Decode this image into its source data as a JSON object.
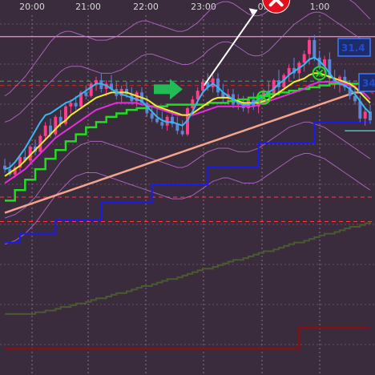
{
  "chart_data": {
    "type": "candlestick",
    "x_tick_labels": [
      "20:00",
      "21:00",
      "22:00",
      "23:00",
      "0:",
      "1:00"
    ],
    "price_tags": [
      "31.4",
      "34"
    ],
    "grid": true,
    "background": "#3a2c3c",
    "colors": {
      "bull_candle": "#ff3d8b",
      "bear_candle": "#5f86d6",
      "fast_ma": "#36b8f0",
      "yellow_ma": "#f2ee2a",
      "magenta_ma": "#e82ce0",
      "green_step": "#22dd22",
      "salmon_ma": "#f2a58c",
      "blue_step": "#1a1aee",
      "olive_step": "#4a5a30",
      "red_step": "#9a0808",
      "bands": "#b86bd0",
      "pink_level": "#f27bc8",
      "grid": "#8a6e88",
      "signal_green": "#22bb55",
      "signal_red": "#e0101c",
      "price_tag_bg": "#1e2c6e",
      "price_tag_border": "#3a7cff"
    },
    "candles": [
      {
        "o": 100,
        "h": 108,
        "l": 92,
        "c": 96
      },
      {
        "o": 96,
        "h": 104,
        "l": 88,
        "c": 90
      },
      {
        "o": 90,
        "h": 100,
        "l": 86,
        "c": 98
      },
      {
        "o": 98,
        "h": 112,
        "l": 94,
        "c": 110
      },
      {
        "o": 110,
        "h": 118,
        "l": 104,
        "c": 106
      },
      {
        "o": 106,
        "h": 124,
        "l": 102,
        "c": 122
      },
      {
        "o": 122,
        "h": 130,
        "l": 112,
        "c": 116
      },
      {
        "o": 116,
        "h": 136,
        "l": 114,
        "c": 134
      },
      {
        "o": 134,
        "h": 150,
        "l": 130,
        "c": 146
      },
      {
        "o": 146,
        "h": 154,
        "l": 132,
        "c": 136
      },
      {
        "o": 136,
        "h": 158,
        "l": 134,
        "c": 156
      },
      {
        "o": 156,
        "h": 164,
        "l": 144,
        "c": 148
      },
      {
        "o": 148,
        "h": 170,
        "l": 146,
        "c": 168
      },
      {
        "o": 168,
        "h": 176,
        "l": 160,
        "c": 172
      },
      {
        "o": 172,
        "h": 180,
        "l": 164,
        "c": 168
      },
      {
        "o": 168,
        "h": 186,
        "l": 166,
        "c": 184
      },
      {
        "o": 184,
        "h": 192,
        "l": 176,
        "c": 180
      },
      {
        "o": 180,
        "h": 196,
        "l": 178,
        "c": 194
      },
      {
        "o": 194,
        "h": 202,
        "l": 186,
        "c": 198
      },
      {
        "o": 198,
        "h": 206,
        "l": 184,
        "c": 188
      },
      {
        "o": 188,
        "h": 198,
        "l": 180,
        "c": 194
      },
      {
        "o": 194,
        "h": 204,
        "l": 186,
        "c": 188
      },
      {
        "o": 188,
        "h": 196,
        "l": 176,
        "c": 180
      },
      {
        "o": 180,
        "h": 192,
        "l": 172,
        "c": 188
      },
      {
        "o": 188,
        "h": 196,
        "l": 178,
        "c": 182
      },
      {
        "o": 182,
        "h": 190,
        "l": 170,
        "c": 174
      },
      {
        "o": 174,
        "h": 186,
        "l": 168,
        "c": 184
      },
      {
        "o": 184,
        "h": 190,
        "l": 170,
        "c": 172
      },
      {
        "o": 172,
        "h": 180,
        "l": 156,
        "c": 160
      },
      {
        "o": 160,
        "h": 168,
        "l": 150,
        "c": 154
      },
      {
        "o": 154,
        "h": 166,
        "l": 148,
        "c": 150
      },
      {
        "o": 150,
        "h": 162,
        "l": 142,
        "c": 146
      },
      {
        "o": 146,
        "h": 158,
        "l": 140,
        "c": 156
      },
      {
        "o": 156,
        "h": 164,
        "l": 144,
        "c": 148
      },
      {
        "o": 148,
        "h": 156,
        "l": 136,
        "c": 140
      },
      {
        "o": 140,
        "h": 152,
        "l": 134,
        "c": 136
      },
      {
        "o": 136,
        "h": 168,
        "l": 134,
        "c": 166
      },
      {
        "o": 166,
        "h": 180,
        "l": 162,
        "c": 176
      },
      {
        "o": 176,
        "h": 190,
        "l": 170,
        "c": 186
      },
      {
        "o": 186,
        "h": 200,
        "l": 180,
        "c": 196
      },
      {
        "o": 196,
        "h": 206,
        "l": 186,
        "c": 190
      },
      {
        "o": 190,
        "h": 204,
        "l": 184,
        "c": 200
      },
      {
        "o": 200,
        "h": 206,
        "l": 180,
        "c": 184
      },
      {
        "o": 184,
        "h": 194,
        "l": 172,
        "c": 178
      },
      {
        "o": 178,
        "h": 188,
        "l": 170,
        "c": 182
      },
      {
        "o": 182,
        "h": 188,
        "l": 166,
        "c": 170
      },
      {
        "o": 170,
        "h": 182,
        "l": 164,
        "c": 172
      },
      {
        "o": 172,
        "h": 180,
        "l": 162,
        "c": 166
      },
      {
        "o": 166,
        "h": 178,
        "l": 160,
        "c": 176
      },
      {
        "o": 176,
        "h": 184,
        "l": 164,
        "c": 168
      },
      {
        "o": 168,
        "h": 180,
        "l": 160,
        "c": 178
      },
      {
        "o": 178,
        "h": 188,
        "l": 170,
        "c": 186
      },
      {
        "o": 186,
        "h": 196,
        "l": 176,
        "c": 180
      },
      {
        "o": 180,
        "h": 200,
        "l": 178,
        "c": 198
      },
      {
        "o": 198,
        "h": 210,
        "l": 184,
        "c": 190
      },
      {
        "o": 190,
        "h": 206,
        "l": 186,
        "c": 204
      },
      {
        "o": 204,
        "h": 216,
        "l": 196,
        "c": 212
      },
      {
        "o": 212,
        "h": 224,
        "l": 200,
        "c": 206
      },
      {
        "o": 206,
        "h": 220,
        "l": 198,
        "c": 218
      },
      {
        "o": 218,
        "h": 232,
        "l": 208,
        "c": 228
      },
      {
        "o": 228,
        "h": 248,
        "l": 216,
        "c": 244
      },
      {
        "o": 244,
        "h": 250,
        "l": 220,
        "c": 224
      },
      {
        "o": 224,
        "h": 232,
        "l": 210,
        "c": 214
      },
      {
        "o": 214,
        "h": 226,
        "l": 206,
        "c": 222
      },
      {
        "o": 222,
        "h": 230,
        "l": 196,
        "c": 200
      },
      {
        "o": 200,
        "h": 210,
        "l": 188,
        "c": 194
      },
      {
        "o": 194,
        "h": 204,
        "l": 184,
        "c": 202
      },
      {
        "o": 202,
        "h": 210,
        "l": 186,
        "c": 190
      },
      {
        "o": 190,
        "h": 198,
        "l": 176,
        "c": 180
      },
      {
        "o": 180,
        "h": 192,
        "l": 170,
        "c": 174
      },
      {
        "o": 174,
        "h": 180,
        "l": 150,
        "c": 154
      },
      {
        "o": 154,
        "h": 166,
        "l": 146,
        "c": 162
      },
      {
        "o": 162,
        "h": 170,
        "l": 148,
        "c": 152
      }
    ],
    "fast_ma": [
      96,
      98,
      104,
      112,
      120,
      130,
      140,
      150,
      158,
      160,
      164,
      168,
      172,
      174,
      178,
      182,
      186,
      190,
      194,
      194,
      192,
      188,
      184,
      182,
      180,
      178,
      176,
      174,
      168,
      162,
      156,
      152,
      150,
      150,
      148,
      146,
      152,
      162,
      174,
      184,
      190,
      194,
      190,
      184,
      180,
      176,
      172,
      170,
      170,
      172,
      176,
      180,
      184,
      188,
      194,
      198,
      204,
      208,
      212,
      216,
      222,
      224,
      220,
      214,
      206,
      198,
      194,
      192,
      188,
      182,
      174,
      166,
      160
    ],
    "yellow_ma": [
      88,
      92,
      96,
      100,
      106,
      112,
      118,
      124,
      130,
      136,
      142,
      148,
      152,
      158,
      162,
      166,
      170,
      174,
      178,
      180,
      182,
      184,
      184,
      184,
      184,
      182,
      180,
      178,
      176,
      172,
      168,
      166,
      164,
      162,
      160,
      158,
      158,
      160,
      164,
      168,
      172,
      176,
      178,
      178,
      178,
      176,
      174,
      172,
      172,
      172,
      172,
      174,
      176,
      180,
      184,
      188,
      192,
      196,
      198,
      200,
      204,
      206,
      206,
      204,
      202,
      200,
      198,
      196,
      194,
      190,
      184,
      178,
      172
    ],
    "magenta_ma": [
      80,
      84,
      88,
      92,
      96,
      102,
      108,
      114,
      120,
      126,
      132,
      136,
      140,
      144,
      148,
      152,
      156,
      160,
      164,
      166,
      168,
      170,
      172,
      172,
      172,
      172,
      172,
      170,
      170,
      168,
      166,
      164,
      162,
      160,
      158,
      158,
      158,
      158,
      160,
      162,
      164,
      166,
      168,
      168,
      168,
      168,
      168,
      168,
      168,
      168,
      170,
      172,
      174,
      176,
      178,
      180,
      182,
      184,
      186,
      188,
      192,
      194,
      196,
      196,
      196,
      196,
      196,
      194,
      192,
      190,
      186,
      182,
      176
    ],
    "salmon_ma": [
      46,
      48,
      50,
      52,
      54,
      56,
      58,
      60,
      62,
      64,
      66,
      68,
      70,
      72,
      74,
      76,
      78,
      80,
      82,
      84,
      86,
      88,
      90,
      92,
      94,
      96,
      98,
      100,
      102,
      104,
      106,
      108,
      110,
      112,
      114,
      116,
      118,
      120,
      122,
      124,
      126,
      128,
      130,
      132,
      134,
      136,
      138,
      140,
      142,
      144,
      146,
      148,
      150,
      152,
      154,
      156,
      158,
      160,
      162,
      164,
      166,
      168,
      170,
      172,
      174,
      176,
      178,
      180,
      182,
      184,
      184,
      186,
      188
    ],
    "band_upper": [
      150,
      152,
      156,
      160,
      166,
      172,
      178,
      184,
      190,
      196,
      202,
      208,
      212,
      214,
      214,
      214,
      212,
      210,
      208,
      206,
      206,
      206,
      208,
      210,
      214,
      218,
      222,
      226,
      228,
      228,
      226,
      224,
      222,
      220,
      218,
      216,
      216,
      218,
      222,
      226,
      232,
      236,
      240,
      242,
      242,
      240,
      236,
      232,
      228,
      226,
      226,
      228,
      232,
      238,
      244,
      250,
      256,
      262,
      266,
      270,
      274,
      276,
      276,
      274,
      270,
      266,
      262,
      258,
      254,
      250,
      246,
      240,
      234
    ],
    "band_lower": [
      40,
      42,
      44,
      48,
      52,
      58,
      64,
      72,
      80,
      88,
      96,
      104,
      110,
      116,
      120,
      124,
      126,
      128,
      128,
      128,
      126,
      124,
      122,
      120,
      118,
      116,
      114,
      112,
      110,
      108,
      106,
      104,
      102,
      100,
      98,
      98,
      100,
      104,
      108,
      112,
      116,
      118,
      120,
      120,
      120,
      118,
      116,
      116,
      116,
      118,
      120,
      124,
      128,
      132,
      136,
      140,
      144,
      146,
      148,
      150,
      150,
      148,
      146,
      144,
      140,
      136,
      132,
      128,
      124,
      120,
      116,
      112,
      108
    ],
    "band_outer_upper": [
      180,
      184,
      190,
      196,
      202,
      210,
      218,
      226,
      234,
      242,
      248,
      252,
      254,
      254,
      252,
      250,
      248,
      246,
      244,
      244,
      244,
      246,
      248,
      252,
      256,
      260,
      264,
      266,
      266,
      264,
      262,
      260,
      258,
      256,
      254,
      254,
      256,
      260,
      264,
      270,
      276,
      282,
      286,
      288,
      288,
      286,
      282,
      278,
      274,
      272,
      272,
      274,
      278,
      284,
      290,
      296,
      302,
      306,
      310,
      312,
      314,
      314,
      312,
      310,
      306,
      302,
      298,
      294,
      290,
      286,
      280,
      274,
      268
    ],
    "band_outer_lower": [
      10,
      12,
      14,
      18,
      22,
      28,
      34,
      42,
      50,
      58,
      66,
      72,
      78,
      84,
      88,
      90,
      92,
      92,
      92,
      90,
      88,
      86,
      84,
      82,
      80,
      78,
      76,
      74,
      72,
      70,
      68,
      66,
      64,
      62,
      62,
      62,
      64,
      66,
      70,
      74,
      78,
      82,
      84,
      86,
      86,
      84,
      82,
      80,
      80,
      80,
      82,
      86,
      90,
      94,
      98,
      102,
      106,
      110,
      112,
      114,
      114,
      112,
      110,
      108,
      104,
      100,
      96,
      92,
      88,
      84,
      80,
      76,
      72
    ],
    "green_step": [
      60,
      60,
      72,
      72,
      84,
      84,
      96,
      96,
      108,
      108,
      118,
      118,
      128,
      128,
      136,
      136,
      144,
      144,
      150,
      150,
      156,
      156,
      160,
      160,
      164,
      164,
      166,
      166,
      168,
      168,
      168,
      168,
      170,
      170,
      170,
      170,
      170,
      170,
      170,
      170,
      172,
      172,
      172,
      172,
      174,
      174,
      176,
      176,
      178,
      178,
      180,
      180,
      182,
      182,
      184,
      184,
      186,
      186,
      188,
      188,
      190,
      190,
      192,
      192,
      194,
      194,
      194,
      194,
      194,
      194,
      192,
      192,
      190
    ],
    "blue_step": [
      12,
      12,
      12,
      22,
      22,
      22,
      22,
      22,
      22,
      22,
      38,
      38,
      38,
      38,
      38,
      38,
      38,
      38,
      38,
      58,
      58,
      58,
      58,
      58,
      58,
      58,
      58,
      58,
      58,
      78,
      78,
      78,
      78,
      78,
      78,
      78,
      78,
      78,
      78,
      78,
      98,
      98,
      98,
      98,
      98,
      98,
      98,
      98,
      98,
      98,
      126,
      126,
      126,
      126,
      126,
      126,
      126,
      126,
      126,
      126,
      126,
      150,
      150,
      150,
      150,
      150,
      150,
      150,
      150,
      150,
      150,
      150,
      150
    ],
    "olive_step": [
      -70,
      -70,
      -70,
      -70,
      -70,
      -70,
      -68,
      -68,
      -66,
      -66,
      -64,
      -62,
      -62,
      -60,
      -58,
      -58,
      -56,
      -54,
      -52,
      -52,
      -50,
      -48,
      -46,
      -46,
      -44,
      -42,
      -40,
      -38,
      -38,
      -36,
      -34,
      -32,
      -30,
      -30,
      -28,
      -26,
      -24,
      -22,
      -20,
      -18,
      -18,
      -16,
      -14,
      -12,
      -10,
      -8,
      -8,
      -6,
      -4,
      -2,
      0,
      2,
      2,
      4,
      6,
      8,
      10,
      12,
      12,
      14,
      16,
      18,
      20,
      22,
      22,
      24,
      26,
      28,
      30,
      30,
      32,
      34,
      36
    ],
    "red_step": [
      -110,
      -110,
      -110,
      -110,
      -110,
      -110,
      -110,
      -110,
      -110,
      -110,
      -110,
      -110,
      -110,
      -110,
      -110,
      -110,
      -110,
      -110,
      -110,
      -110,
      -110,
      -110,
      -110,
      -110,
      -110,
      -110,
      -110,
      -110,
      -110,
      -110,
      -110,
      -110,
      -110,
      -110,
      -110,
      -110,
      -110,
      -110,
      -110,
      -110,
      -110,
      -110,
      -110,
      -110,
      -110,
      -110,
      -110,
      -110,
      -110,
      -110,
      -110,
      -110,
      -110,
      -110,
      -110,
      -110,
      -110,
      -110,
      -86,
      -86,
      -86,
      -86,
      -86,
      -86,
      -86,
      -86,
      -86,
      -86,
      -86,
      -86,
      -86,
      -86,
      -86
    ],
    "horizontal_levels": [
      {
        "value": 248,
        "color": "#f27bc8",
        "style": "solid"
      },
      {
        "value": 197,
        "color": "#22bb55",
        "style": "dashed"
      },
      {
        "value": 192,
        "color": "#cc2a2a",
        "style": "dashed"
      },
      {
        "value": 140,
        "color": "#31d0d0",
        "style": "solid",
        "from_candle": 67
      },
      {
        "value": 64,
        "color": "#ff3b3b",
        "style": "dashed"
      },
      {
        "value": 36,
        "color": "#ff3b3b",
        "style": "dashed"
      }
    ],
    "signals": [
      {
        "type": "buy-arrow",
        "at_candle": 36,
        "value": 184
      },
      {
        "type": "sell-x",
        "at_candle": 56,
        "value": 276
      },
      {
        "type": "cross",
        "at_candle": 51,
        "value": 178
      },
      {
        "type": "cross",
        "at_candle": 62,
        "value": 206
      },
      {
        "type": "sell-arrow",
        "at_candle": 72,
        "value": 194
      }
    ],
    "ylim": [
      -140,
      290
    ]
  }
}
